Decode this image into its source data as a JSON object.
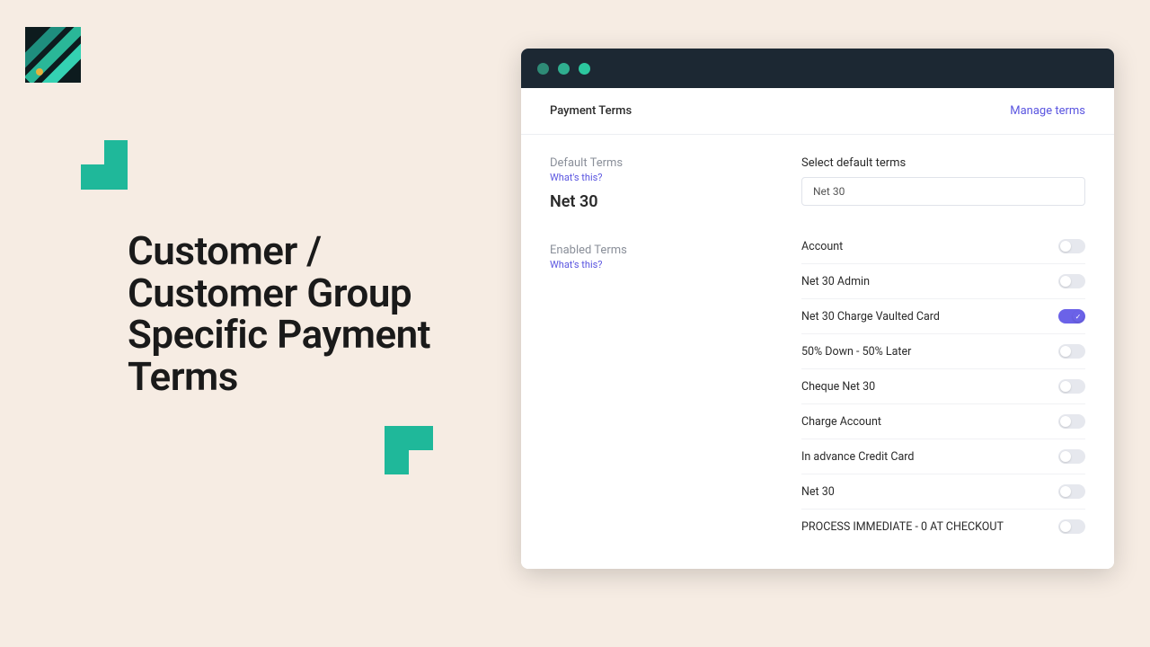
{
  "hero": {
    "title": "Customer / Customer Group Specific Payment Terms"
  },
  "panel": {
    "title": "Payment Terms",
    "manage_link": "Manage terms",
    "default_terms_label": "Default Terms",
    "whats_this": "What's this?",
    "current_default": "Net 30",
    "select_label": "Select default terms",
    "select_value": "Net 30",
    "enabled_terms_label": "Enabled Terms",
    "terms": [
      {
        "label": "Account",
        "on": false
      },
      {
        "label": "Net 30 Admin",
        "on": false
      },
      {
        "label": "Net 30 Charge Vaulted Card",
        "on": true
      },
      {
        "label": "50% Down - 50% Later",
        "on": false
      },
      {
        "label": "Cheque Net 30",
        "on": false
      },
      {
        "label": "Charge Account",
        "on": false
      },
      {
        "label": "In advance Credit Card",
        "on": false
      },
      {
        "label": "Net 30",
        "on": false
      },
      {
        "label": "PROCESS IMMEDIATE - 0 AT CHECKOUT",
        "on": false
      }
    ]
  }
}
